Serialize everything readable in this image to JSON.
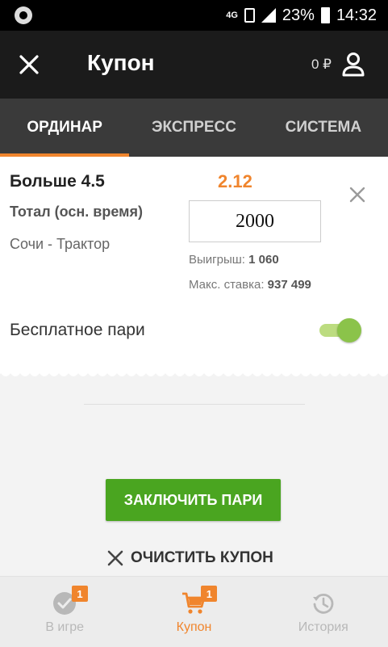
{
  "status_bar": {
    "network": "4G",
    "battery": "23%",
    "time": "14:32"
  },
  "header": {
    "title": "Купон",
    "balance": "0 ₽"
  },
  "tabs": [
    {
      "label": "ОРДИНАР",
      "active": true
    },
    {
      "label": "ЭКСПРЕСС",
      "active": false
    },
    {
      "label": "СИСТЕМА",
      "active": false
    }
  ],
  "bet": {
    "title": "Больше 4.5",
    "type": "Тотал (осн. время)",
    "match": "Сочи - Трактор",
    "odds": "2.12",
    "stake": "2000",
    "win_label": "Выигрыш:",
    "win_value": "1 060",
    "max_label": "Макс. ставка:",
    "max_value": "937 499"
  },
  "free_bet": {
    "label": "Бесплатное пари",
    "enabled": true
  },
  "actions": {
    "submit": "ЗАКЛЮЧИТЬ ПАРИ",
    "clear": "ОЧИСТИТЬ КУПОН"
  },
  "bottom_nav": [
    {
      "label": "В игре",
      "badge": "1",
      "icon": "check-circle-icon"
    },
    {
      "label": "Купон",
      "badge": "1",
      "icon": "cart-icon"
    },
    {
      "label": "История",
      "icon": "history-icon"
    }
  ],
  "colors": {
    "accent": "#f0852d",
    "green": "#4aa520",
    "header": "#1b1b1b",
    "tabs": "#3a3a3a"
  }
}
